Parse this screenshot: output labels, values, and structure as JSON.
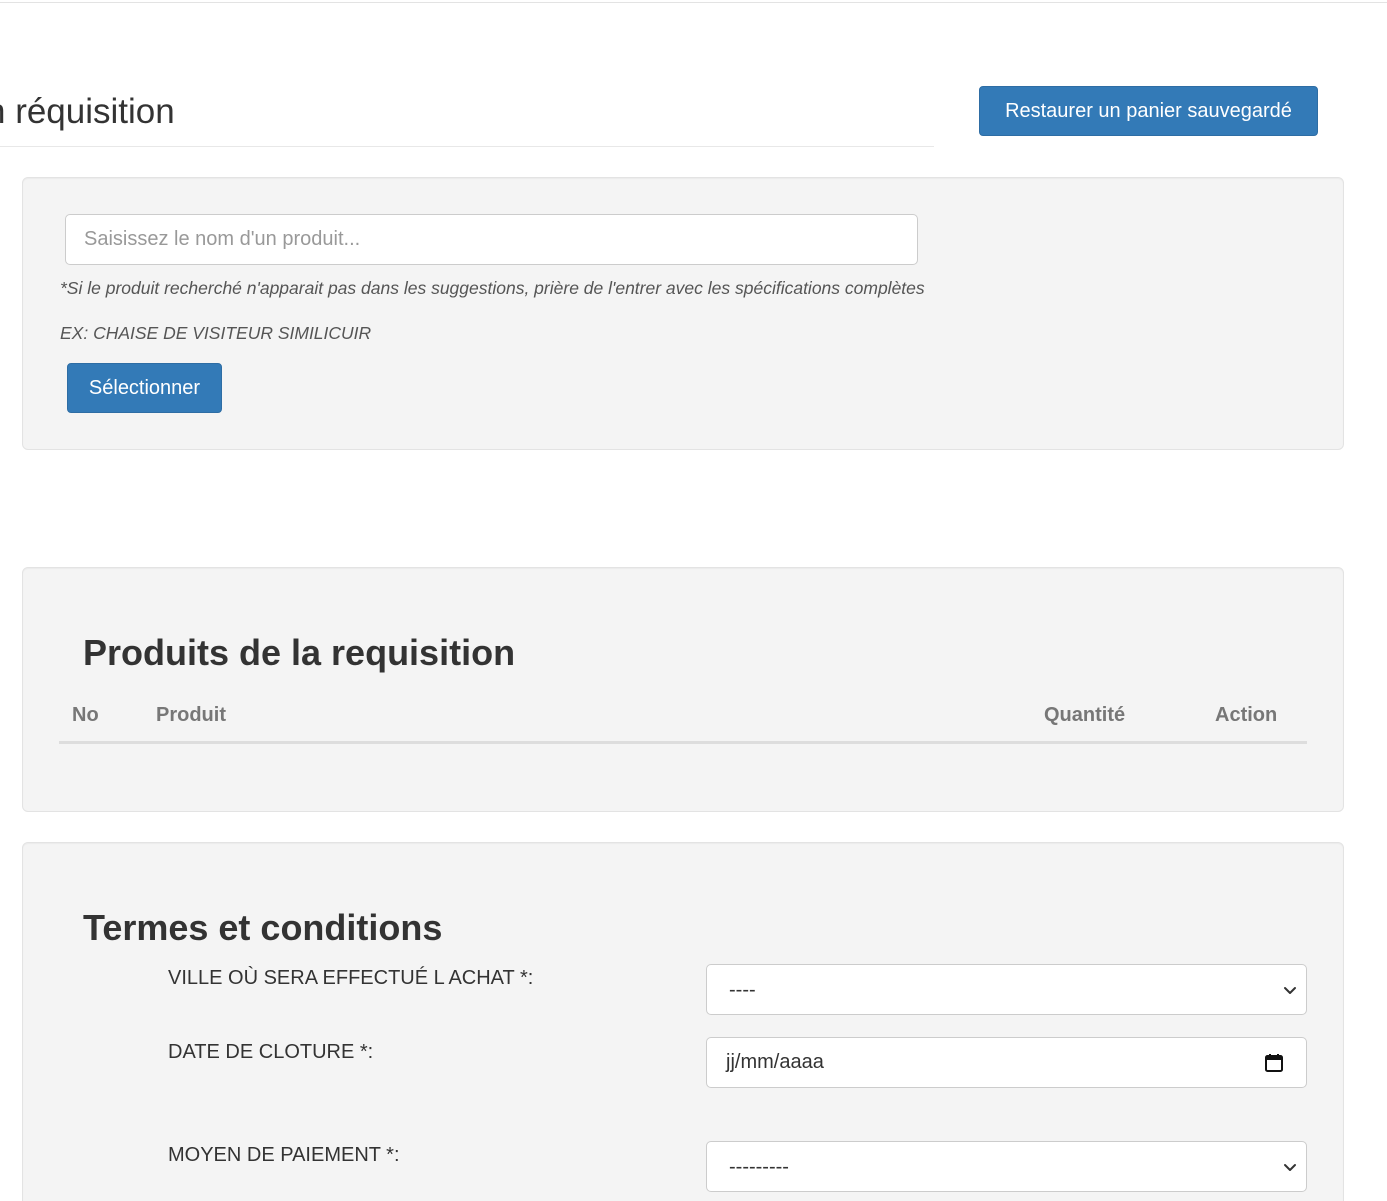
{
  "header": {
    "page_title": "n réquisition",
    "restore_button_label": "Restaurer un panier sauvegardé"
  },
  "search": {
    "placeholder": "Saisissez le nom d'un produit...",
    "hint_text": "*Si le produit recherché n'apparait pas dans les suggestions, prière de l'entrer avec les spécifications complètes",
    "example_text": "EX: CHAISE DE VISITEUR SIMILICUIR",
    "select_button_label": "Sélectionner"
  },
  "products": {
    "heading": "Produits de la requisition",
    "columns": [
      "No",
      "Produit",
      "Quantité",
      "Action"
    ],
    "rows": []
  },
  "terms": {
    "heading": "Termes et conditions",
    "city_label": "VILLE OÙ SERA EFFECTUÉ L ACHAT *:",
    "city_value": "----",
    "close_date_label": "DATE DE CLOTURE *:",
    "close_date_value": "jj/mm/aaaa",
    "payment_label": "MOYEN DE PAIEMENT *:",
    "payment_value": "---------"
  },
  "icons": {
    "select_arrow": "chevron-down-icon",
    "date_picker": "calendar-icon"
  },
  "colors": {
    "primary_button": "#337ab7",
    "well_background": "#f4f4f4",
    "table_header_text": "#777777"
  }
}
